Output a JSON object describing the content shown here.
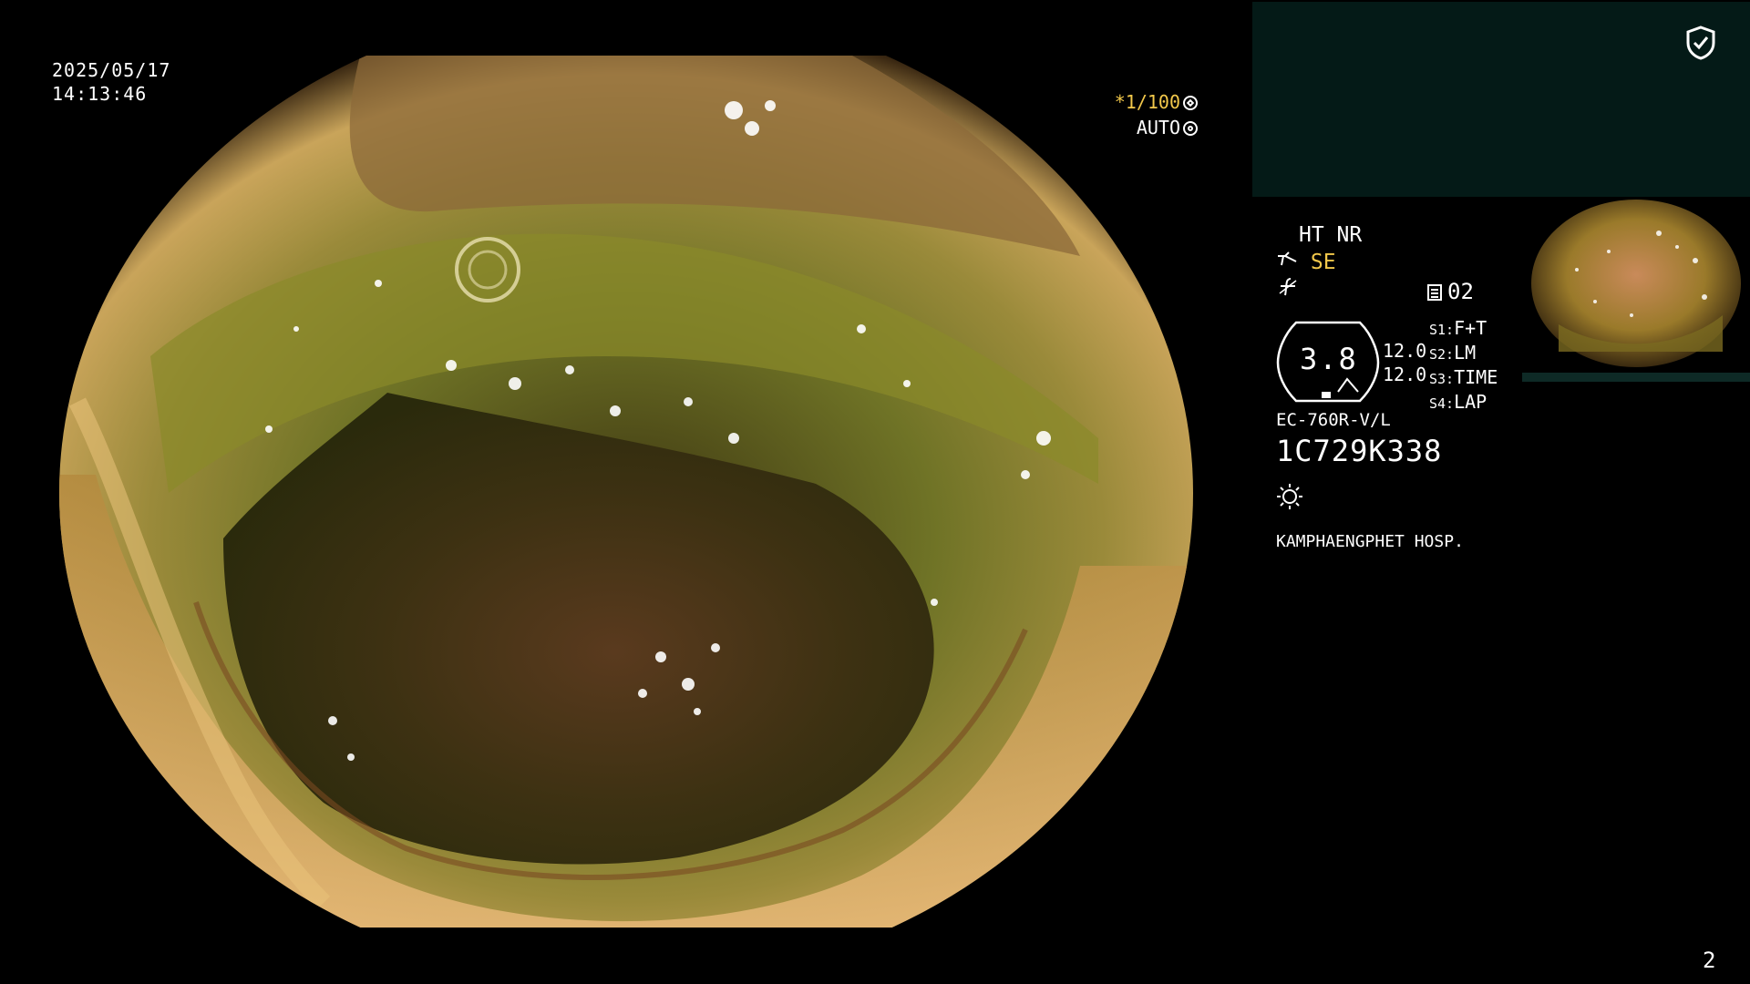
{
  "overlay": {
    "date": "2025/05/17",
    "time": "14:13:46",
    "shutter_prefix": "*",
    "shutter_speed": "1/100",
    "exposure_mode": "AUTO"
  },
  "panel": {
    "mode_label": "HT NR",
    "se_label": "SE",
    "f_symbol": "f",
    "frame_count": "02",
    "zoom_value": "3.8",
    "setting_1": "12.0",
    "setting_2": "12.0",
    "switches": [
      {
        "key": "S1:",
        "value": "F+T"
      },
      {
        "key": "S2:",
        "value": "LM"
      },
      {
        "key": "S3:",
        "value": "TIME"
      },
      {
        "key": "S4:",
        "value": "LAP"
      }
    ],
    "scope_model": "EC-760R-V/L",
    "serial_number": "1C729K338",
    "hospital": "KAMPHAENGPHET HOSP.",
    "page_number": "2"
  },
  "colors": {
    "accent_yellow": "#f2c84b",
    "top_panel_bg": "#041a17"
  },
  "icons": [
    "shield-check-icon",
    "camera-icon",
    "signal-icon",
    "document-icon",
    "light-source-icon",
    "shutter-icon",
    "auto-exposure-icon"
  ]
}
